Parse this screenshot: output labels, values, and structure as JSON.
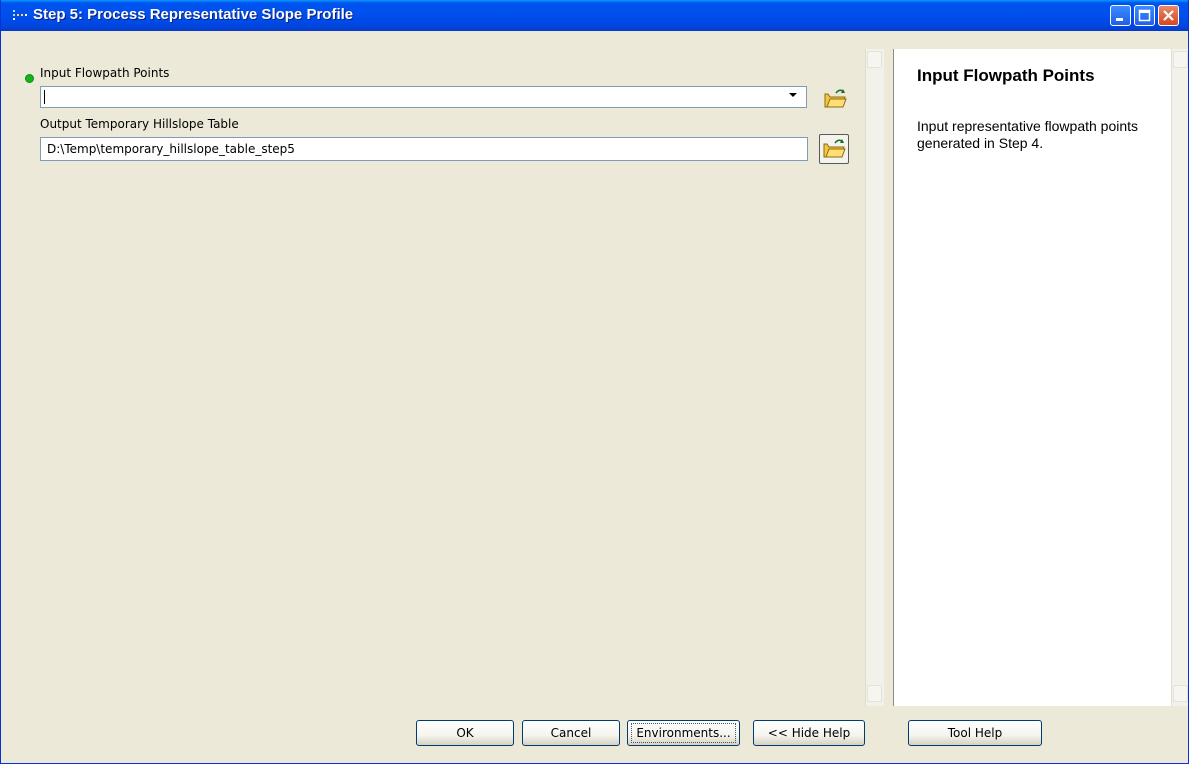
{
  "window": {
    "title": "Step 5: Process Representative Slope Profile",
    "icon": "toolbox-dots-icon",
    "controls": [
      "minimize-icon",
      "maximize-icon",
      "close-icon"
    ]
  },
  "form": {
    "input_flowpath": {
      "label": "Input Flowpath Points",
      "value": "",
      "required": true,
      "required_color": "#16b516"
    },
    "output_table": {
      "label": "Output Temporary Hillslope Table",
      "value": "D:\\Temp\\temporary_hillslope_table_step5"
    }
  },
  "help": {
    "title": "Input Flowpath Points",
    "text": "Input representative flowpath points generated in Step 4."
  },
  "buttons": {
    "ok": "OK",
    "cancel": "Cancel",
    "environments": "Environments...",
    "hide_help": "<< Hide Help",
    "tool_help": "Tool Help"
  },
  "colors": {
    "titlebar": "#0053ee",
    "dialog_bg": "#ece9d8",
    "field_border": "#7f9db9"
  }
}
